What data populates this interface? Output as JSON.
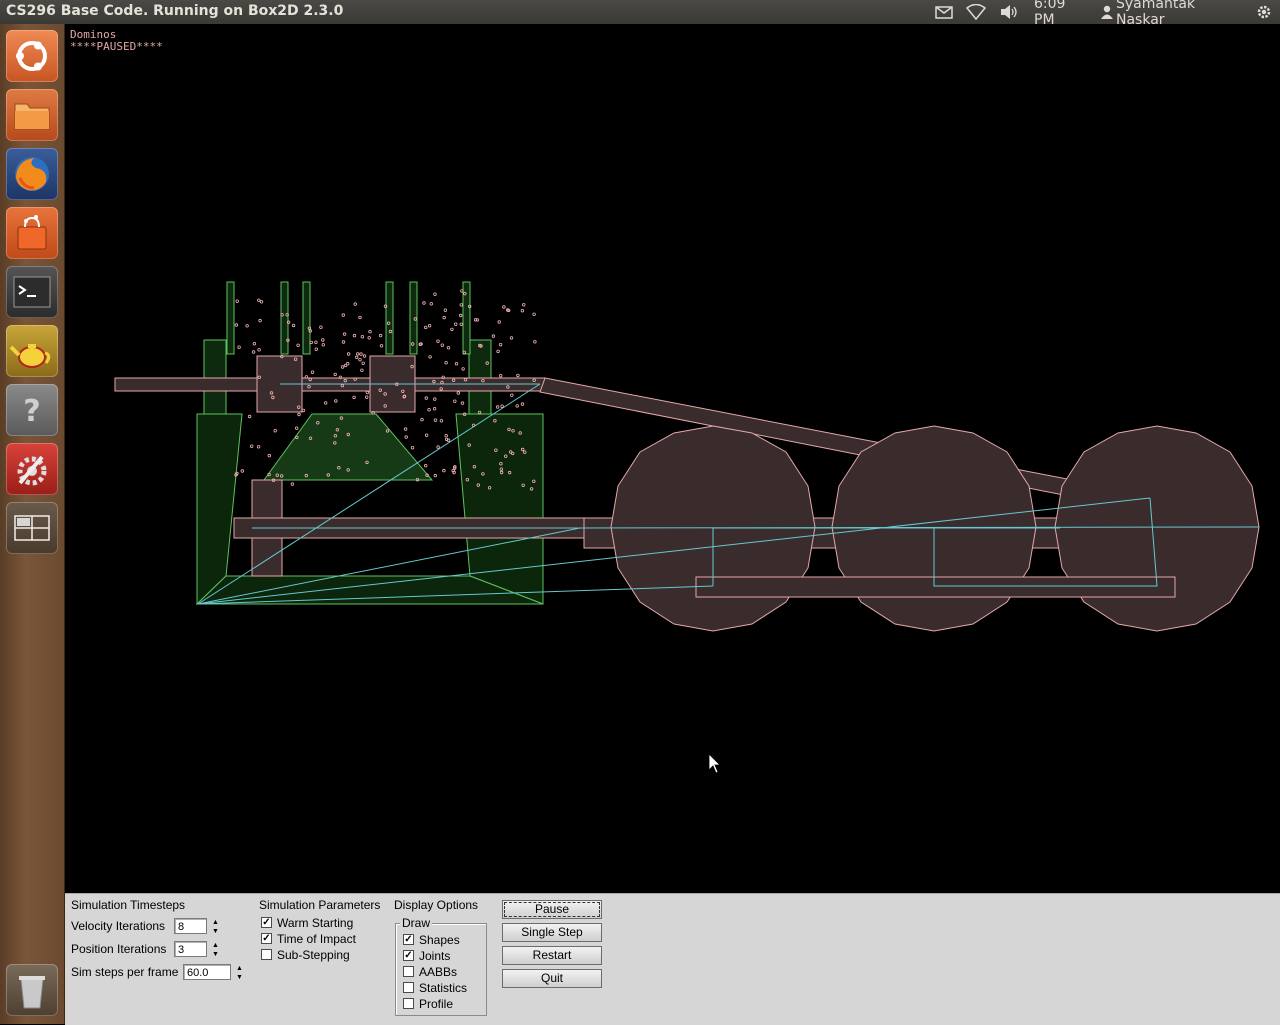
{
  "window": {
    "title": "CS296 Base Code. Running on Box2D 2.3.0"
  },
  "indicators": {
    "mail_icon": "envelope-icon",
    "network_icon": "wifi-icon",
    "sound_icon": "volume-icon",
    "time": "6:09 PM",
    "user_icon": "person-icon",
    "user": "Syamantak Naskar",
    "settings_icon": "gear-icon"
  },
  "launcher": {
    "items": [
      {
        "name": "dash-home",
        "icon": "ubuntu-logo-icon"
      },
      {
        "name": "files",
        "icon": "folder-icon"
      },
      {
        "name": "firefox",
        "icon": "firefox-icon"
      },
      {
        "name": "software-center",
        "icon": "shopping-bag-icon"
      },
      {
        "name": "terminal",
        "icon": "terminal-icon"
      },
      {
        "name": "teapot",
        "icon": "teapot-icon"
      },
      {
        "name": "help",
        "icon": "question-icon"
      },
      {
        "name": "system-settings",
        "icon": "wrench-gear-icon"
      },
      {
        "name": "workspace-switcher",
        "icon": "workspaces-icon"
      },
      {
        "name": "trash",
        "icon": "trash-icon"
      }
    ]
  },
  "simulation": {
    "scene_name": "Dominos",
    "status": "****PAUSED****",
    "colors": {
      "static_body": "#5ec25e",
      "static_fill": "#0e2a0e",
      "dynamic_body": "#e6a8a8",
      "dynamic_fill": "#3a2c2c",
      "joint": "#66c8d0",
      "particle": "#f0b0b0"
    }
  },
  "panel": {
    "timesteps": {
      "heading": "Simulation Timesteps",
      "velocity_label": "Velocity Iterations",
      "velocity_value": "8",
      "position_label": "Position Iterations",
      "position_value": "3",
      "hz_label": "Sim steps per frame",
      "hz_value": "60.0"
    },
    "parameters": {
      "heading": "Simulation Parameters",
      "options": [
        {
          "label": "Warm Starting",
          "checked": true
        },
        {
          "label": "Time of Impact",
          "checked": true
        },
        {
          "label": "Sub-Stepping",
          "checked": false
        }
      ]
    },
    "display": {
      "heading": "Display Options",
      "group_label": "Draw",
      "options": [
        {
          "label": "Shapes",
          "checked": true
        },
        {
          "label": "Joints",
          "checked": true
        },
        {
          "label": "AABBs",
          "checked": false
        },
        {
          "label": "Statistics",
          "checked": false
        },
        {
          "label": "Profile",
          "checked": false
        }
      ]
    },
    "buttons": {
      "pause": "Pause",
      "single_step": "Single Step",
      "restart": "Restart",
      "quit": "Quit"
    }
  }
}
